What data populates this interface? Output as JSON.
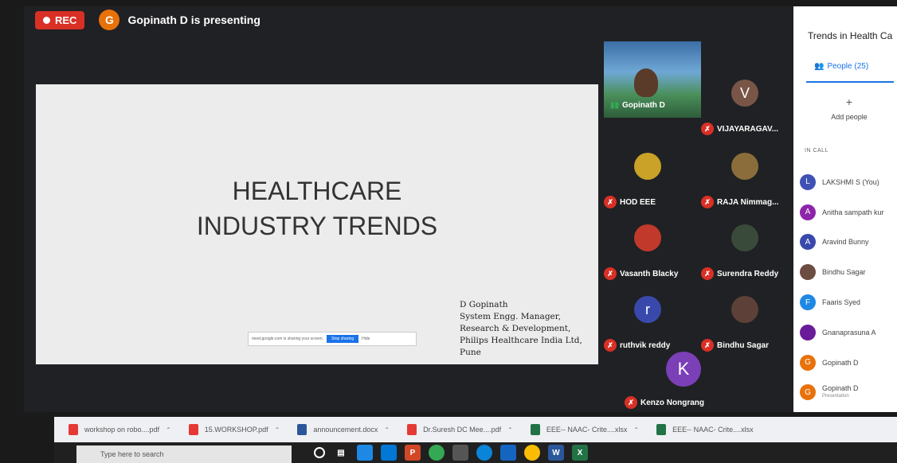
{
  "recording": {
    "label": "REC"
  },
  "presenter": {
    "initial": "G",
    "text": "Gopinath D is presenting"
  },
  "slide": {
    "title_line1": "HEALTHCARE",
    "title_line2": "INDUSTRY TRENDS",
    "author_lines": [
      "D Gopinath",
      "System Engg. Manager,",
      "Research & Development,",
      "Philips Healthcare India Ltd,",
      "Pune"
    ],
    "share_bar": {
      "text": "meet.google.com is sharing your screen.",
      "stop_label": "Stop sharing",
      "hide_label": "Hide"
    }
  },
  "tiles": [
    {
      "name": "Gopinath D",
      "kind": "video"
    },
    {
      "name": "VIJAYARAGAV...",
      "initial": "V",
      "color": "#795548"
    },
    {
      "name": "HOD EEE",
      "initial": "",
      "color": "#c9a227"
    },
    {
      "name": "RAJA Nimmag...",
      "initial": "",
      "color": "#8a6d3b"
    },
    {
      "name": "Vasanth Blacky",
      "initial": "",
      "color": "#c0392b"
    },
    {
      "name": "Surendra Reddy",
      "initial": "",
      "color": "#3a4a3a"
    },
    {
      "name": "ruthvik reddy",
      "initial": "r",
      "color": "#3949ab"
    },
    {
      "name": "Bindhu Sagar",
      "initial": "",
      "color": "#5d4037"
    },
    {
      "name": "Kenzo Nongrang",
      "initial": "K",
      "color": "#7b3fb8"
    }
  ],
  "side_panel": {
    "title": "Trends in Health Ca",
    "people_tab": "People (25)",
    "add_people": "Add people",
    "in_call_label": "IN CALL",
    "participants": [
      {
        "name": "LAKSHMI S (You)",
        "initial": "L",
        "color": "#3f51b5"
      },
      {
        "name": "Anitha sampath kur",
        "initial": "A",
        "color": "#8e24aa"
      },
      {
        "name": "Aravind Bunny",
        "initial": "A",
        "color": "#3949ab"
      },
      {
        "name": "Bindhu Sagar",
        "initial": "",
        "color": "#6d4c41"
      },
      {
        "name": "Faaris Syed",
        "initial": "F",
        "color": "#1e88e5"
      },
      {
        "name": "Gnanaprasuna A",
        "initial": "",
        "color": "#6a1b9a"
      },
      {
        "name": "Gopinath D",
        "initial": "G",
        "color": "#e8710a"
      },
      {
        "name": "Gopinath D",
        "sub": "Presentation",
        "initial": "G",
        "color": "#e8710a"
      }
    ]
  },
  "downloads": [
    {
      "name": "workshop on robo....pdf",
      "color": "#e53935"
    },
    {
      "name": "15.WORKSHOP.pdf",
      "color": "#e53935"
    },
    {
      "name": "announcement.docx",
      "color": "#2b579a"
    },
    {
      "name": "Dr.Suresh DC Mee....pdf",
      "color": "#e53935"
    },
    {
      "name": "EEE-- NAAC- Crite....xlsx",
      "color": "#217346"
    },
    {
      "name": "EEE-- NAAC- Crite....xlsx",
      "color": "#217346"
    }
  ],
  "taskbar": {
    "search_placeholder": "Type here to search",
    "apps": [
      {
        "icon": "task-view-icon",
        "color": "#202020"
      },
      {
        "icon": "store-icon",
        "color": "#1e88e5"
      },
      {
        "icon": "briefcase-icon",
        "color": "#0078d4"
      },
      {
        "icon": "powerpoint-icon",
        "color": "#d24726"
      },
      {
        "icon": "chrome-icon",
        "color": "#34a853"
      },
      {
        "icon": "camera-icon",
        "color": "#555"
      },
      {
        "icon": "edge-icon",
        "color": "#0a84d8"
      },
      {
        "icon": "cursor-icon",
        "color": "#1565c0"
      },
      {
        "icon": "chrome-icon",
        "color": "#fbbc05"
      },
      {
        "icon": "word-icon",
        "color": "#2b579a"
      },
      {
        "icon": "excel-icon",
        "color": "#217346"
      }
    ]
  }
}
